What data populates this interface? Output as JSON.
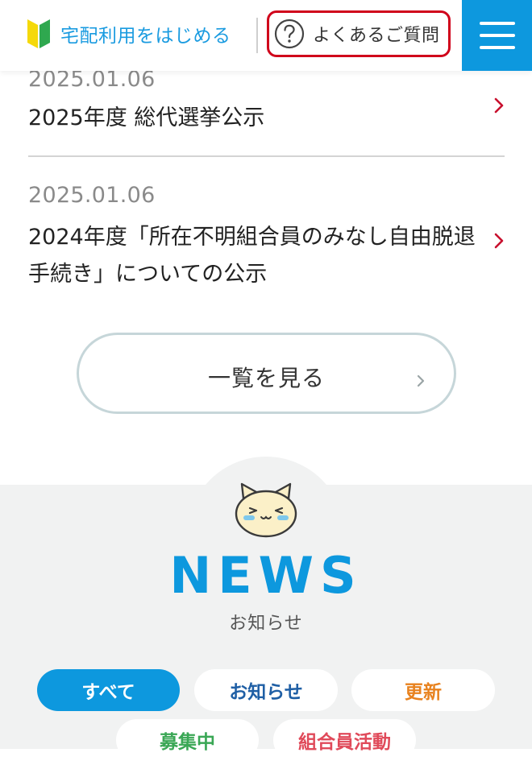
{
  "header": {
    "beginner_label": "宅配利用をはじめる",
    "faq_label": "よくあるご質問",
    "brand_color": "#0d98de",
    "highlight_color": "#d0021b"
  },
  "news_list": [
    {
      "date": "2025.01.06",
      "title": "2025年度 総代選挙公示"
    },
    {
      "date": "2025.01.06",
      "title": "2024年度「所在不明組合員のみなし自由脱退手続き」についての公示"
    }
  ],
  "view_all_label": "一覧を見る",
  "news_section": {
    "heading": "NEWS",
    "subheading": "お知らせ",
    "filters": [
      {
        "label": "すべて",
        "active": true,
        "color": "#ffffff"
      },
      {
        "label": "お知らせ",
        "active": false,
        "color": "#1f5fa5"
      },
      {
        "label": "更新",
        "active": false,
        "color": "#e8821e"
      },
      {
        "label": "募集中",
        "active": false,
        "color": "#3aa755"
      },
      {
        "label": "組合員活動",
        "active": false,
        "color": "#e04a5a"
      }
    ]
  },
  "icons": [
    "beginner-mark-icon",
    "question-icon",
    "hamburger-menu-icon",
    "chevron-right-icon",
    "cat-mascot-icon"
  ]
}
